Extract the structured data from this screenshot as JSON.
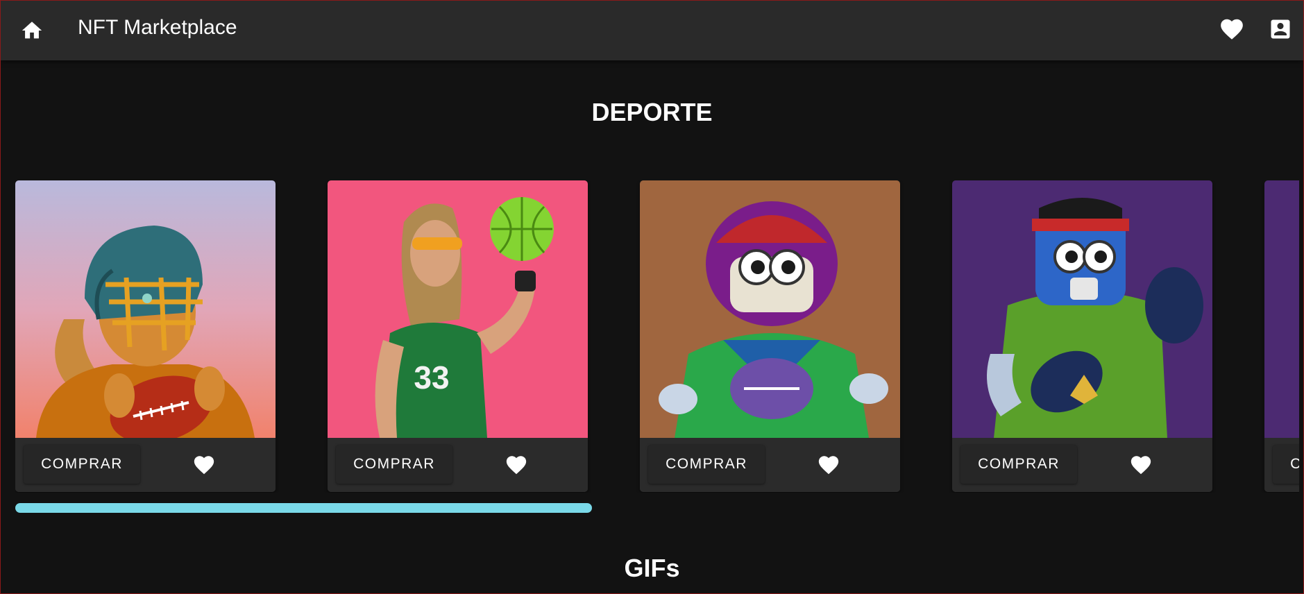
{
  "header": {
    "home_icon": "home-icon",
    "title": "NFT Marketplace",
    "favorites_icon": "heart-icon",
    "account_icon": "account-box-icon"
  },
  "sections": [
    {
      "title": "DEPORTE",
      "cards": [
        {
          "art": "lion-football-player",
          "background": "#c4a8c9",
          "buy_label": "COMPRAR",
          "like_icon": "heart-icon"
        },
        {
          "art": "basketball-player-33",
          "background": "#f2567e",
          "buy_label": "COMPRAR",
          "like_icon": "heart-icon"
        },
        {
          "art": "robot-football-player",
          "background": "#a0663f",
          "buy_label": "COMPRAR",
          "like_icon": "heart-icon"
        },
        {
          "art": "robot-boxer",
          "background": "#4c2a72",
          "buy_label": "COMPRAR",
          "like_icon": "heart-icon"
        },
        {
          "art": "partial-card",
          "background": "#4c2a72",
          "buy_label": "COMPRAR",
          "like_icon": "heart-icon"
        }
      ]
    },
    {
      "title": "GIFs"
    }
  ],
  "colors": {
    "background": "#121212",
    "appbar": "#2a2a2a",
    "card": "#2b2b2b",
    "scrollbar": "#7ad9e8"
  }
}
